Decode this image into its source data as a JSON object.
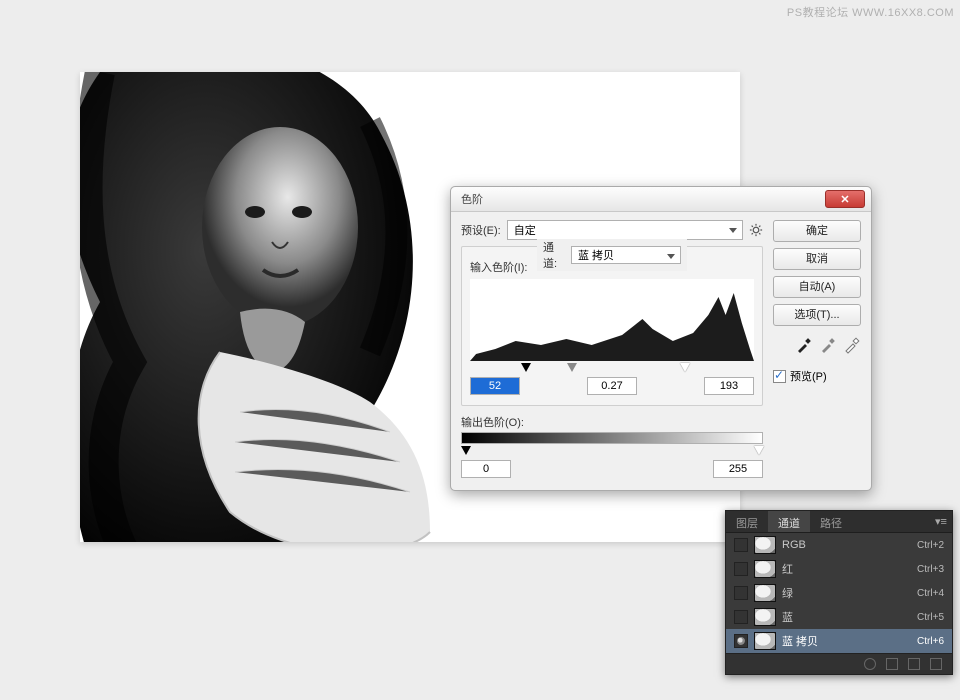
{
  "watermark": "PS教程论坛 WWW.16XX8.COM",
  "dialog": {
    "title": "色阶",
    "preset_label": "预设(E):",
    "preset_value": "自定",
    "channel_label": "通道:",
    "channel_value": "蓝 拷贝",
    "input_label": "输入色阶(I):",
    "shadows": "52",
    "midtones": "0.27",
    "highlights": "193",
    "output_label": "输出色阶(O):",
    "output_min": "0",
    "output_max": "255",
    "buttons": {
      "ok": "确定",
      "cancel": "取消",
      "auto": "自动(A)",
      "options": "选项(T)..."
    },
    "preview": "预览(P)"
  },
  "panel": {
    "tabs": {
      "layers": "图层",
      "channels": "通道",
      "paths": "路径"
    },
    "rows": [
      {
        "name": "RGB",
        "shortcut": "Ctrl+2",
        "visible": false,
        "selected": false
      },
      {
        "name": "红",
        "shortcut": "Ctrl+3",
        "visible": false,
        "selected": false
      },
      {
        "name": "绿",
        "shortcut": "Ctrl+4",
        "visible": false,
        "selected": false
      },
      {
        "name": "蓝",
        "shortcut": "Ctrl+5",
        "visible": false,
        "selected": false
      },
      {
        "name": "蓝 拷贝",
        "shortcut": "Ctrl+6",
        "visible": true,
        "selected": true
      }
    ]
  }
}
